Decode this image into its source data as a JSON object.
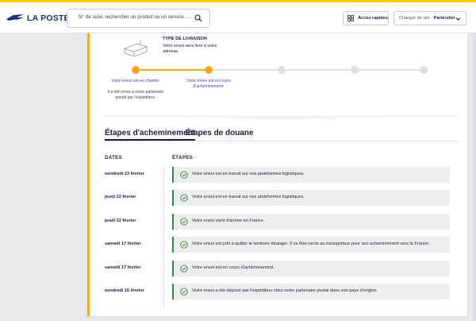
{
  "brand": {
    "name": "LA POSTE"
  },
  "header": {
    "search_placeholder": "N° de suivi, rechercher un produit ou un service....",
    "quick_access_label": "Accès rapides",
    "site_label": "Changer de site :",
    "site_value": "Particulier"
  },
  "delivery": {
    "title": "TYPE DE LIVRAISON",
    "description": "Votre envoi sera livré à votre adresse."
  },
  "timeline": {
    "progress": 0.25,
    "steps": [
      {
        "label": "Votre envoi est en chemin.",
        "sub": "Il a été remis à notre partenaire postal par l'expéditeur.",
        "done": true
      },
      {
        "label": "Votre envoi est en cours d'acheminement.",
        "sub": "",
        "done": true
      },
      {
        "label": "",
        "sub": "",
        "done": false
      },
      {
        "label": "",
        "sub": "",
        "done": false
      },
      {
        "label": "",
        "sub": "",
        "done": false
      }
    ]
  },
  "tabs": [
    {
      "label": "Étapes d'acheminement",
      "active": true
    },
    {
      "label": "Étapes de douane",
      "active": false
    }
  ],
  "table": {
    "col_dates": "DATES",
    "col_steps": "ÉTAPES",
    "rows": [
      {
        "date": "vendredi 23 février",
        "event": "Votre envoi est en transit sur nos plateformes logistiques."
      },
      {
        "date": "jeudi 22 février",
        "event": "Votre envoi est en transit sur nos plateformes logistiques."
      },
      {
        "date": "jeudi 22 février",
        "event": "Votre envoi vient d'arriver en France."
      },
      {
        "date": "samedi 17 février",
        "event": "Votre envoi est prêt à quitter le territoire étranger. Il va être remis au transporteur pour son acheminement vers la France."
      },
      {
        "date": "samedi 17 février",
        "event": "Votre envoi est en cours d'acheminement."
      },
      {
        "date": "vendredi 16 février",
        "event": "Votre envoi a été déposé par l'expéditeur chez notre partenaire postal dans son pays d'origine."
      }
    ]
  },
  "colors": {
    "accent": "#ffc800",
    "progress": "#f5a623",
    "brand_navy": "#1a2f6f",
    "success": "#2e8b3e"
  },
  "icons": {
    "logo": "la-poste-bird-logo",
    "search": "search-icon",
    "quick": "grid-icon",
    "chevron": "chevron-down-icon",
    "check": "check-circle-icon",
    "parcel": "parcel-icon"
  }
}
